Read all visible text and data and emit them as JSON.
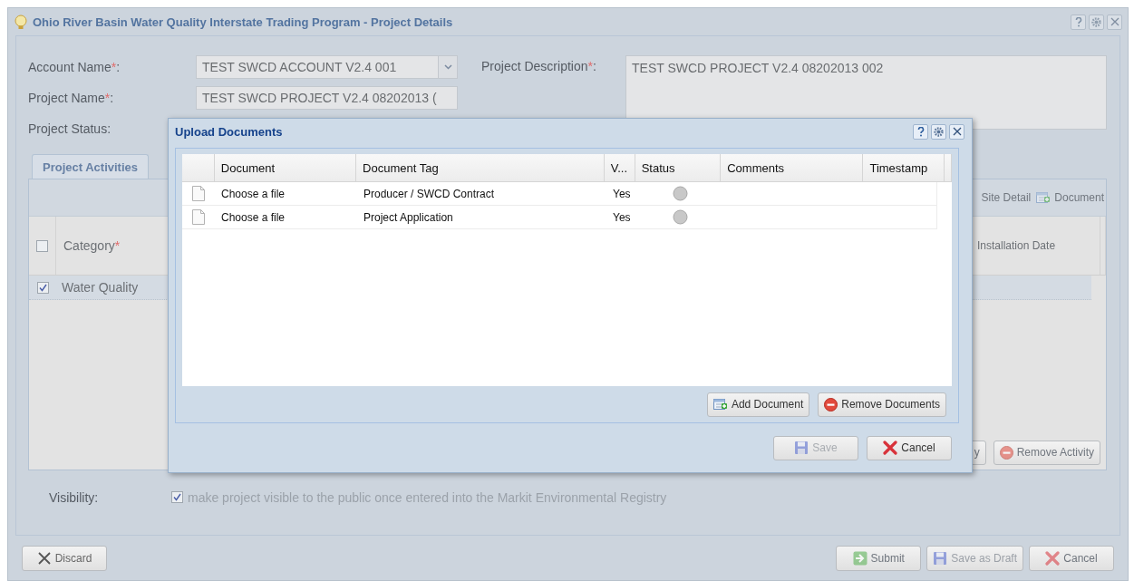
{
  "window": {
    "title": "Ohio River Basin Water Quality Interstate Trading Program - Project Details"
  },
  "form": {
    "fields": [
      {
        "kind": "dropdown",
        "label": "Account Name",
        "mark": "*",
        "end": ":",
        "value": "TEST SWCD ACCOUNT V2.4 001"
      },
      {
        "kind": "text",
        "label": "Project Name",
        "mark": "*",
        "end": ":",
        "value": "TEST SWCD PROJECT V2.4 08202013 ("
      },
      {
        "kind": "empty",
        "label": "Project Status:"
      }
    ],
    "description": {
      "label": "Project Description",
      "mark": "*",
      "end": ":",
      "value": "TEST SWCD PROJECT V2.4 08202013 002"
    }
  },
  "tabs": [
    {
      "label": "Project Activities",
      "selected": true
    }
  ],
  "activities": {
    "toolbar": [
      {
        "label": "Site Detail",
        "kind": "none"
      },
      {
        "label": "Document",
        "kind": "add"
      }
    ],
    "header_checked": false,
    "columns": [
      {
        "label": "Category",
        "mark": "*"
      },
      {
        "label": "Installation Date"
      }
    ],
    "rows": [
      {
        "checked": true,
        "category": "Water Quality"
      }
    ],
    "buttons": [
      {
        "label": "y",
        "kind": "none"
      },
      {
        "label": "Remove Activity",
        "kind": "remove"
      }
    ]
  },
  "visibility": {
    "label": "Visibility:",
    "checked": true,
    "text": "make project visible to the public once entered into the Markit Environmental Registry"
  },
  "footer": {
    "left": [
      {
        "label": "Discard",
        "kind": "discard",
        "disabled": false
      }
    ],
    "right": [
      {
        "label": "Submit",
        "kind": "submit",
        "disabled": false
      },
      {
        "label": "Save as Draft",
        "kind": "save",
        "disabled": true
      },
      {
        "label": "Cancel",
        "kind": "cancel",
        "disabled": false
      }
    ]
  },
  "dialog": {
    "title": "Upload Documents",
    "columns": [
      "Document",
      "Document Tag",
      "V...",
      "Status",
      "Comments",
      "Timestamp"
    ],
    "rows": [
      {
        "document": "Choose a file",
        "tag": "Producer / SWCD Contract",
        "v": "Yes"
      },
      {
        "document": "Choose a file",
        "tag": "Project Application",
        "v": "Yes"
      }
    ],
    "actions": [
      {
        "label": "Add Document",
        "kind": "add",
        "disabled": false
      },
      {
        "label": "Remove Documents",
        "kind": "remove",
        "disabled": false
      }
    ],
    "buttons": [
      {
        "label": "Save",
        "kind": "save",
        "disabled": true
      },
      {
        "label": "Cancel",
        "kind": "cancel",
        "disabled": false
      }
    ]
  }
}
